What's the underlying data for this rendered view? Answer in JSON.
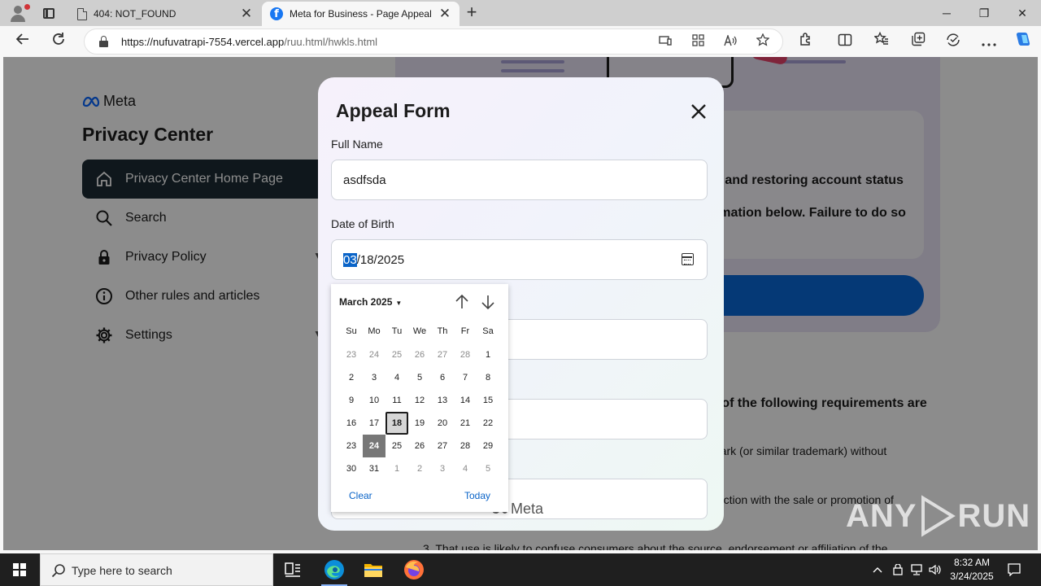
{
  "browser": {
    "tabs": [
      {
        "title": "404: NOT_FOUND",
        "icon": "document-icon",
        "active": false
      },
      {
        "title": "Meta for Business - Page Appeal",
        "icon": "facebook-icon",
        "active": true
      }
    ],
    "url": {
      "host": "https://nufuvatrapi-7554.vercel.app",
      "path": "/ruu.html/hwkls.html"
    },
    "window_controls": {
      "minimize": "─",
      "maximize": "❐",
      "close": "✕"
    },
    "new_tab": "+"
  },
  "page": {
    "logo_text": "Meta",
    "privacy_title": "Privacy Center",
    "nav": [
      {
        "label": "Privacy Center Home Page",
        "icon": "home-icon",
        "active": true,
        "chevron": false
      },
      {
        "label": "Search",
        "icon": "search-icon",
        "active": false,
        "chevron": false
      },
      {
        "label": "Privacy Policy",
        "icon": "lock-icon",
        "active": false,
        "chevron": true
      },
      {
        "label": "Other rules and articles",
        "icon": "info-icon",
        "active": false,
        "chevron": false
      },
      {
        "label": "Settings",
        "icon": "gear-icon",
        "active": false,
        "chevron": true
      }
    ],
    "background_text": {
      "line1": "s and restoring account status",
      "line2": "rmation below. Failure to do so",
      "requirements": "e of the following requirements are",
      "item1": "mark (or similar trademark) without",
      "item2": "nection with the sale or promotion of",
      "item3": "3. That use is likely to confuse consumers about the source, endorsement or affiliation of the"
    }
  },
  "modal": {
    "title": "Appeal Form",
    "full_name_label": "Full Name",
    "full_name_value": "asdfsda",
    "dob_label": "Date of Birth",
    "dob_month": "03",
    "dob_rest": "/18/2025",
    "footer_logo_text": "Meta"
  },
  "datepicker": {
    "month_label": "March 2025",
    "weekdays": [
      "Su",
      "Mo",
      "Tu",
      "We",
      "Th",
      "Fr",
      "Sa"
    ],
    "days": [
      {
        "d": "23",
        "out": true
      },
      {
        "d": "24",
        "out": true
      },
      {
        "d": "25",
        "out": true
      },
      {
        "d": "26",
        "out": true
      },
      {
        "d": "27",
        "out": true
      },
      {
        "d": "28",
        "out": true
      },
      {
        "d": "1"
      },
      {
        "d": "2"
      },
      {
        "d": "3"
      },
      {
        "d": "4"
      },
      {
        "d": "5"
      },
      {
        "d": "6"
      },
      {
        "d": "7"
      },
      {
        "d": "8"
      },
      {
        "d": "9"
      },
      {
        "d": "10"
      },
      {
        "d": "11"
      },
      {
        "d": "12"
      },
      {
        "d": "13"
      },
      {
        "d": "14"
      },
      {
        "d": "15"
      },
      {
        "d": "16"
      },
      {
        "d": "17"
      },
      {
        "d": "18",
        "selected": true
      },
      {
        "d": "19"
      },
      {
        "d": "20"
      },
      {
        "d": "21"
      },
      {
        "d": "22"
      },
      {
        "d": "23"
      },
      {
        "d": "24",
        "today": true
      },
      {
        "d": "25"
      },
      {
        "d": "26"
      },
      {
        "d": "27"
      },
      {
        "d": "28"
      },
      {
        "d": "29"
      },
      {
        "d": "30"
      },
      {
        "d": "31"
      },
      {
        "d": "1",
        "out": true
      },
      {
        "d": "2",
        "out": true
      },
      {
        "d": "3",
        "out": true
      },
      {
        "d": "4",
        "out": true
      },
      {
        "d": "5",
        "out": true
      }
    ],
    "clear_label": "Clear",
    "today_label": "Today"
  },
  "watermark": {
    "left": "ANY",
    "right": "RUN"
  },
  "taskbar": {
    "search_placeholder": "Type here to search",
    "apps": [
      "task-view-icon",
      "edge-icon",
      "file-explorer-icon",
      "firefox-icon"
    ],
    "time": "8:32 AM",
    "date": "3/24/2025"
  },
  "colors": {
    "accent": "#0a64c8",
    "nav_active": "#1c2b33",
    "cta_blue": "#0a68d8",
    "taskbar": "#1f1f1f"
  }
}
